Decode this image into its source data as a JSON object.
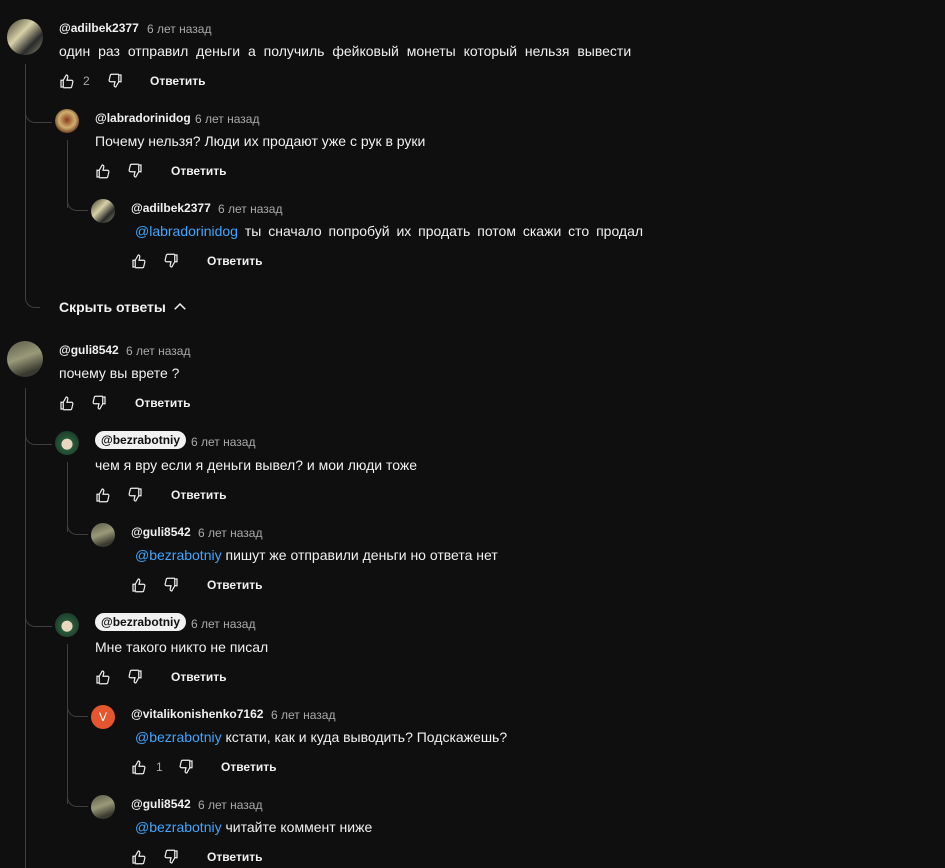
{
  "actions": {
    "reply_label": "Ответить"
  },
  "colors": {
    "background": "#0f0f0f",
    "mention": "#3ea6ff",
    "secondary_text": "#aaaaaa",
    "orange_avatar": "#e4572e"
  },
  "threads": [
    {
      "author": "@adilbek2377",
      "time": "6 лет назад",
      "text": "один раз отправил деньги а получиль фейковый монеты который нельзя вывести",
      "likes": "2",
      "replies": [
        {
          "author": "@labradorinidog",
          "time": "6 лет назад",
          "text": "Почему нельзя? Люди их продают уже с рук в руки"
        },
        {
          "author": "@adilbek2377",
          "time": "6 лет назад",
          "mention": "@labradorinidog",
          "text": "ты сначало попробуй их продать потом скажи сто продал"
        }
      ],
      "toggle_label": "Скрыть ответы"
    },
    {
      "author": "@guli8542",
      "time": "6 лет назад",
      "text": "почему вы врете ?",
      "replies": [
        {
          "author": "@bezrabotniy",
          "time": "6 лет назад",
          "text": "чем я вру если я деньги вывел? и мои люди тоже"
        },
        {
          "author": "@guli8542",
          "time": "6 лет назад",
          "mention": "@bezrabotniy",
          "text": "пишут же отправили деньги но ответа нет"
        },
        {
          "author": "@bezrabotniy",
          "time": "6 лет назад",
          "text": "Мне такого никто не писал"
        },
        {
          "author": "@vitalikonishenko7162",
          "time": "6 лет назад",
          "mention": "@bezrabotniy",
          "text": "кстати, как и куда выводить? Подскажешь?",
          "likes": "1",
          "avatar_letter": "V"
        },
        {
          "author": "@guli8542",
          "time": "6 лет назад",
          "mention": "@bezrabotniy",
          "text": "читайте коммент ниже"
        }
      ]
    }
  ]
}
